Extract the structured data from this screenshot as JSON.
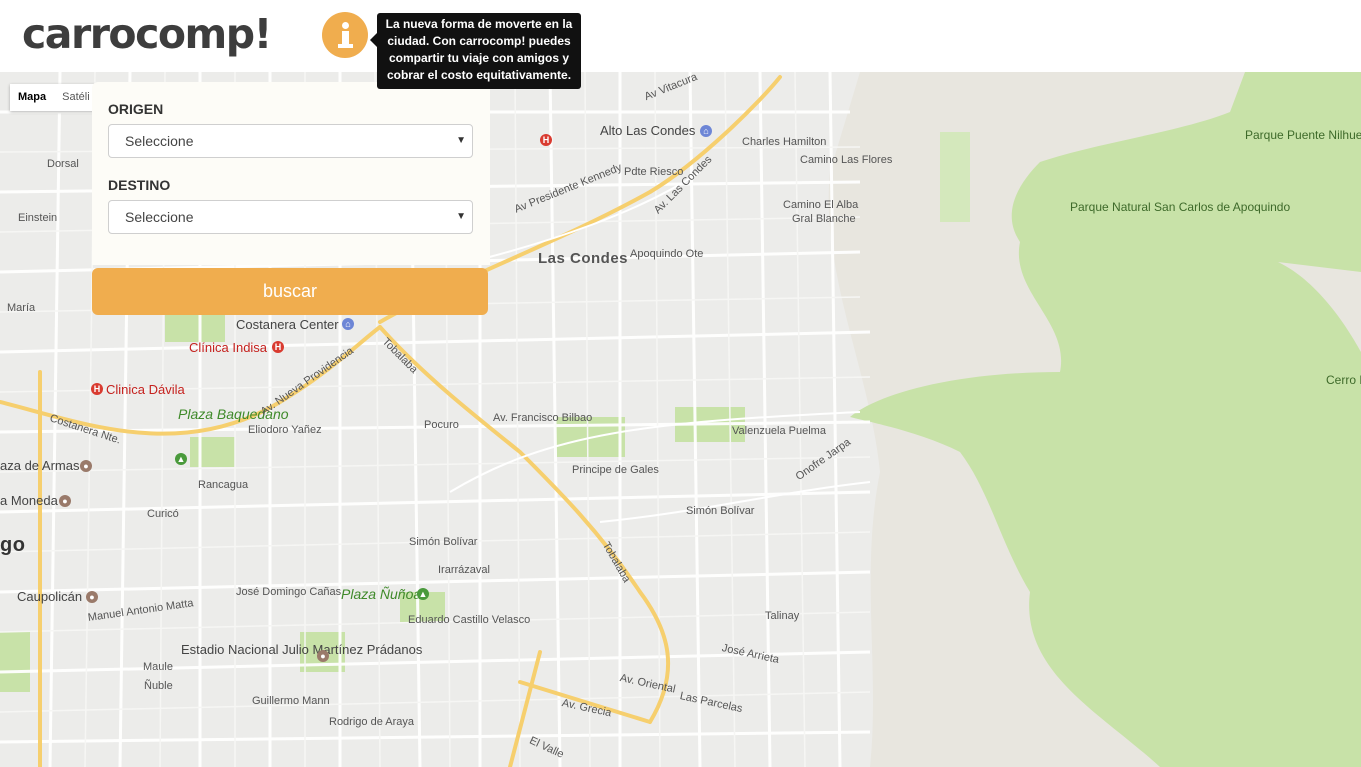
{
  "header": {
    "logo": "carrocomp!",
    "info_tooltip": "La nueva forma de moverte en la ciudad. Con carrocomp! puedes compartir tu viaje con amigos y cobrar el costo equitativamente."
  },
  "map_type": {
    "map": "Mapa",
    "satellite": "Satéli"
  },
  "form": {
    "origin_label": "ORIGEN",
    "origin_value": "Seleccione",
    "destination_label": "DESTINO",
    "destination_value": "Seleccione",
    "search_button": "buscar"
  },
  "map_labels": {
    "las_condes": "Las Condes",
    "alto_las_condes": "Alto Las Condes",
    "costanera_center": "Costanera Center",
    "clinica_indisa": "Clínica Indisa",
    "clinica_davila": "Clinica Dávila",
    "plaza_baquedano": "Plaza Baquedano",
    "plaza_nunoa": "Plaza Ñuñoa",
    "estadio": "Estadio Nacional Julio Martínez Prádanos",
    "caupolican": "Caupolicán",
    "plaza_armas": "aza de Armas",
    "la_moneda": "a Moneda",
    "santiago": "go",
    "parque_puente_nilhue": "Parque Puente Nilhue",
    "parque_natural": "Parque Natural San Carlos de Apoquindo",
    "cerro_provincia": "Cerro Provincia",
    "av_vitacura": "Av Vitacura",
    "charles_hamilton": "Charles Hamilton",
    "camino_las_flores": "Camino Las Flores",
    "camino_el_alba": "Camino El Alba",
    "gral_blanche": "Gral Blanche",
    "av_presidente_kennedy": "Av Presidente Kennedy",
    "av_las_condes": "Av. Las Condes",
    "pdte_riesco": "Pdte Riesco",
    "apoquindo_ote": "Apoquindo Ote",
    "av_francisco_bilbao": "Av. Francisco Bilbao",
    "principe_de_gales": "Principe de Gales",
    "valenzuela_puelma": "Valenzuela Puelma",
    "onofre_jarpa": "Onofre Jarpa",
    "simon_bolivar": "Simón Bolívar",
    "av_grecia": "Av. Grecia",
    "av_oriental": "Av. Oriental",
    "las_parcelas": "Las Parcelas",
    "jose_arrieta": "José Arrieta",
    "talinay": "Talinay",
    "tobalaba": "Tobalaba",
    "av_nueva_providencia": "Av. Nueva Providencia",
    "costanera_nte": "Costanera Nte.",
    "eliodoro_yanez": "Eliodoro Yañez",
    "rancagua": "Rancagua",
    "pocuro": "Pocuro",
    "irarrazaval": "Irarrázaval",
    "jose_domingo_canas": "José Domingo Cañas",
    "manuel_antonio_matta": "Manuel Antonio Matta",
    "eduardo_castillo_velasco": "Eduardo Castillo Velasco",
    "rodrigo_de_araya": "Rodrigo de Araya",
    "guillermo_mann": "Guillermo Mann",
    "el_valle": "El Valle",
    "einstein": "Einstein",
    "dorsal": "Dorsal",
    "maria": "María",
    "curico": "Curicó",
    "nuble": "Ñuble",
    "maule": "Maule"
  },
  "colors": {
    "accent": "#f0ad4e",
    "map_background": "#ececea",
    "park": "#c8e2a8",
    "main_road": "#f6cf6e"
  }
}
